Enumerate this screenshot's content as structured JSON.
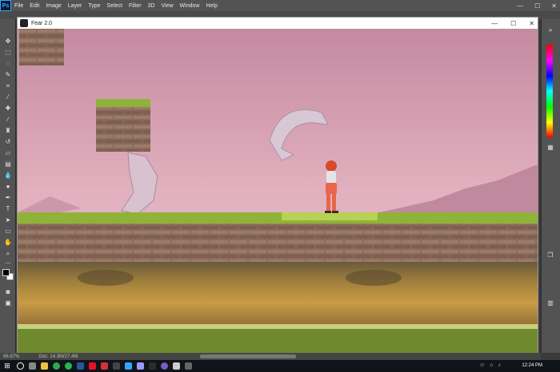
{
  "photoshop": {
    "logo": "Ps",
    "menu": [
      "File",
      "Edit",
      "Image",
      "Layer",
      "Type",
      "Select",
      "Filter",
      "3D",
      "View",
      "Window",
      "Help"
    ],
    "window_controls": [
      "—",
      "☐",
      "✕"
    ]
  },
  "game_window": {
    "title": "Fear 2.0",
    "controls": [
      "—",
      "☐",
      "✕"
    ]
  },
  "status_bar": {
    "zoom": "66.67%",
    "doc": "Doc: 14.3M/27.4M"
  },
  "taskbar": {
    "clock_time": "12:24 PM",
    "tray_icons": [
      "people-icon",
      "network-icon",
      "volume-icon"
    ]
  },
  "colors": {
    "sky_top": "#c98fa3",
    "grass": "#8fb339",
    "dirt": "#8a6a55",
    "character_hair": "#d64a2a",
    "character_suit": "#e8674a"
  }
}
